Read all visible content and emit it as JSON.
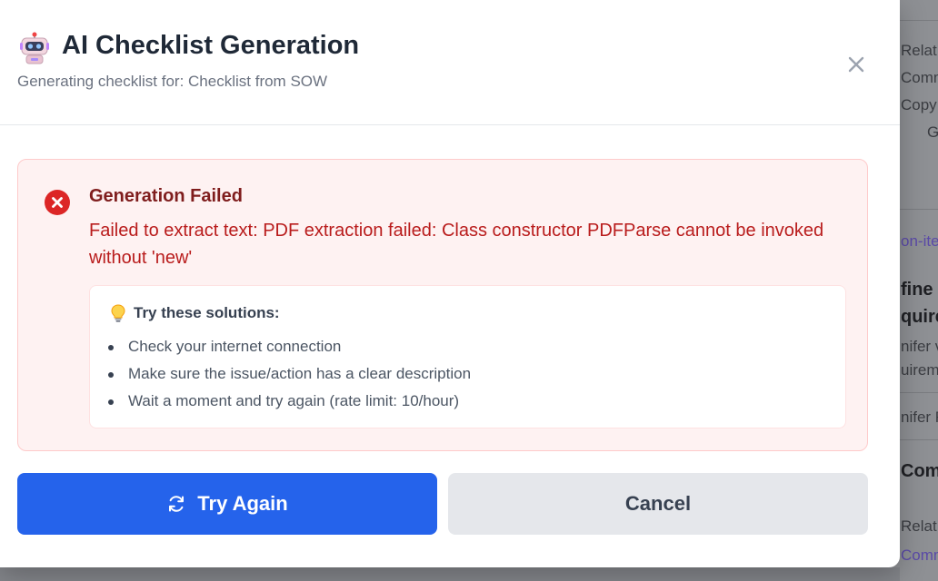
{
  "modal": {
    "title": "AI Checklist Generation",
    "subtitle": "Generating checklist for: Checklist from SOW",
    "close_icon": "close-icon",
    "header_icon": "robot-icon"
  },
  "error": {
    "icon": "error-x-icon",
    "title": "Generation Failed",
    "message": "Failed to extract text: PDF extraction failed: Class constructor PDFParse cannot be invoked without 'new'",
    "solutions": {
      "icon": "lightbulb-icon",
      "title": "Try these solutions:",
      "items": [
        "Check your internet connection",
        "Make sure the issue/action has a clear description",
        "Wait a moment and try again (rate limit: 10/hour)"
      ]
    }
  },
  "actions": {
    "retry_label": "Try Again",
    "retry_icon": "refresh-icon",
    "cancel_label": "Cancel"
  },
  "background": {
    "items": [
      "Relat",
      "Comm",
      "Copy",
      "G",
      "on-ite",
      "fine",
      "quire",
      "nifer v",
      "uirem",
      "nifer R",
      "Com",
      "Relat",
      "Comm"
    ]
  },
  "colors": {
    "primary": "#2563eb",
    "error_text": "#b91c1c",
    "error_title": "#7f1d1d",
    "error_bg": "#fef2f2",
    "error_border": "#fecaca",
    "error_icon": "#dc2626"
  }
}
